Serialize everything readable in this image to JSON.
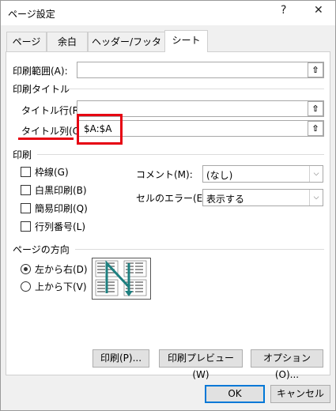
{
  "window": {
    "title": "ページ設定",
    "help_glyph": "?",
    "close_glyph": "✕"
  },
  "tabs": [
    {
      "label": "ページ"
    },
    {
      "label": "余白"
    },
    {
      "label": "ヘッダー/フッター"
    },
    {
      "label": "シート"
    }
  ],
  "sheet": {
    "print_area_label": "印刷範囲(A):",
    "print_area_value": "",
    "print_titles_group": "印刷タイトル",
    "title_rows_label": "タイトル行(R):",
    "title_rows_value": "",
    "title_cols_label": "タイトル列(C):",
    "title_cols_value": "$A:$A",
    "print_group": "印刷",
    "checkboxes": [
      {
        "label": "枠線(G)",
        "checked": false
      },
      {
        "label": "白黒印刷(B)",
        "checked": false
      },
      {
        "label": "簡易印刷(Q)",
        "checked": false
      },
      {
        "label": "行列番号(L)",
        "checked": false
      }
    ],
    "comments_label": "コメント(M):",
    "comments_value": "(なし)",
    "errors_label": "セルのエラー(E):",
    "errors_value": "表示する",
    "order_group": "ページの方向",
    "order_options": [
      {
        "label": "左から右(D)",
        "selected": true
      },
      {
        "label": "上から下(V)",
        "selected": false
      }
    ]
  },
  "buttons": {
    "print": "印刷(P)...",
    "preview": "印刷プレビュー(W)",
    "options": "オプション(O)...",
    "ok": "OK",
    "cancel": "キャンセル"
  },
  "colors": {
    "highlight": "#e60012",
    "accent": "#0078d7",
    "arrow": "#1e8080"
  },
  "icons": {
    "ref_button": "collapse-dialog-icon",
    "dropdown": "chevron-down-icon"
  }
}
